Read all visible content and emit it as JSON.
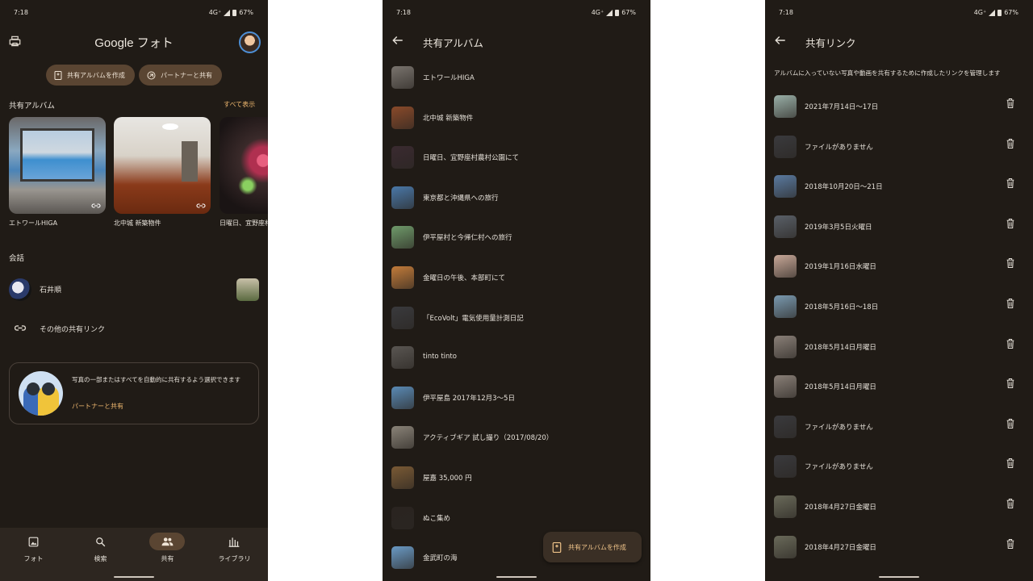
{
  "status": {
    "time": "7:18",
    "network": "4G⁺",
    "battery": "67%"
  },
  "screen1": {
    "logo": "Google フォト",
    "chips": {
      "create_album": "共有アルバムを作成",
      "partner_share": "パートナーと共有"
    },
    "shared_albums_label": "共有アルバム",
    "see_all": "すべて表示",
    "albums": [
      {
        "name": "エトワールHIGA"
      },
      {
        "name": "北中城 新築物件"
      },
      {
        "name": "日曜日、宜野座村"
      }
    ],
    "conversations_label": "会話",
    "conversation": {
      "name": "石井順"
    },
    "other_links": "その他の共有リンク",
    "promo": {
      "text": "写真の一部またはすべてを自動的に共有するよう選択できます",
      "link": "パートナーと共有"
    },
    "nav": [
      {
        "label": "フォト",
        "icon": "photo-icon",
        "active": false
      },
      {
        "label": "検索",
        "icon": "search-icon",
        "active": false
      },
      {
        "label": "共有",
        "icon": "people-icon",
        "active": true
      },
      {
        "label": "ライブラリ",
        "icon": "library-icon",
        "active": false
      }
    ]
  },
  "screen2": {
    "title": "共有アルバム",
    "albums": [
      {
        "name": "エトワールHIGA",
        "thumb": "#7a746e"
      },
      {
        "name": "北中城 新築物件",
        "thumb": "#8a4a2a"
      },
      {
        "name": "日曜日、宜野座村農村公園にて",
        "thumb": "#3a2a30"
      },
      {
        "name": "東京都と沖縄県への旅行",
        "thumb": "#4a78a8"
      },
      {
        "name": "伊平屋村と今帰仁村への旅行",
        "thumb": "#6f9a6a"
      },
      {
        "name": "金曜日の午後、本部町にて",
        "thumb": "#c27b3a"
      },
      {
        "name": "「EcoVolt」電気使用量計測日記",
        "thumb": "#3a3a3d"
      },
      {
        "name": "tinto tinto",
        "thumb": "#5a5652"
      },
      {
        "name": "伊平屋島 2017年12月3〜5日",
        "thumb": "#5a8ab5"
      },
      {
        "name": "アクティブギア 試し撮り（2017/08/20）",
        "thumb": "#8a8378"
      },
      {
        "name": "屋嘉 35,000 円",
        "thumb": "#7a5a35"
      },
      {
        "name": "ぬこ集め",
        "thumb": "#2a2420"
      },
      {
        "name": "金武町の海",
        "thumb": "#6a9ac5"
      }
    ],
    "fab_label": "共有アルバムを作成"
  },
  "screen3": {
    "title": "共有リンク",
    "description": "アルバムに入っていない写真や動画を共有するために作成したリンクを管理します",
    "links": [
      {
        "label": "2021年7月14日〜17日",
        "thumb": "#9ab0a8"
      },
      {
        "label": "ファイルがありません",
        "thumb": "#3a3a3d"
      },
      {
        "label": "2018年10月20日〜21日",
        "thumb": "#5a7aa0"
      },
      {
        "label": "2019年3月5日火曜日",
        "thumb": "#5a6068"
      },
      {
        "label": "2019年1月16日水曜日",
        "thumb": "#c8a898"
      },
      {
        "label": "2018年5月16日〜18日",
        "thumb": "#7a9ab0"
      },
      {
        "label": "2018年5月14日月曜日",
        "thumb": "#8a8078"
      },
      {
        "label": "2018年5月14日月曜日",
        "thumb": "#8a8078"
      },
      {
        "label": "ファイルがありません",
        "thumb": "#3a3a3d"
      },
      {
        "label": "ファイルがありません",
        "thumb": "#3a3a3d"
      },
      {
        "label": "2018年4月27日金曜日",
        "thumb": "#6a6a5a"
      },
      {
        "label": "2018年4月27日金曜日",
        "thumb": "#6a6a5a"
      }
    ]
  }
}
